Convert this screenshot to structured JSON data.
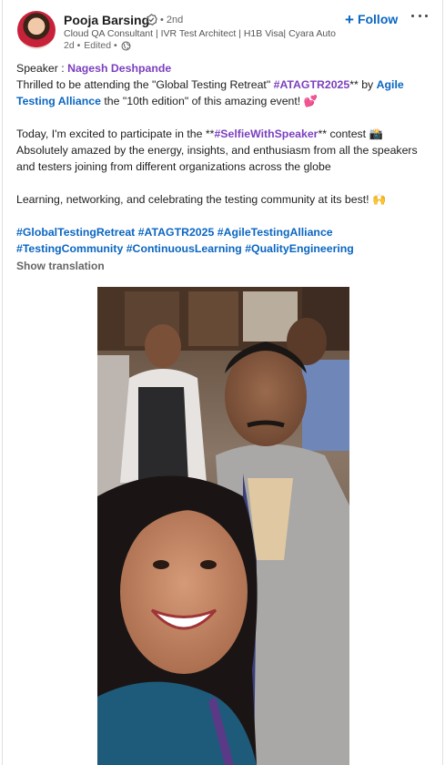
{
  "author": {
    "name": "Pooja Barsing",
    "degree": "• 2nd",
    "headline": "Cloud QA Consultant | IVR Test Architect | H1B Visa| Cyara Auto…",
    "time": "2d •",
    "edited": "Edited •"
  },
  "actions": {
    "follow_label": "Follow",
    "follow_icon": "plus-icon",
    "more_icon": "more-horizontal-icon"
  },
  "post": {
    "speaker_prefix": "Speaker : ",
    "speaker_name": "Nagesh Deshpande",
    "line2_a": "Thrilled to be attending the \"Global Testing Retreat\" ",
    "line2_tag": "#ATAGTR2025",
    "line2_b": "** by ",
    "line2_mention": "Agile Testing Alliance",
    "line2_c": " the \"10th edition\" of this amazing event! 💕",
    "line3_a": "Today, I'm excited to participate in the **",
    "line3_tag": "#SelfieWithSpeaker",
    "line3_b": "** contest 📸 Absolutely amazed by the energy, insights, and enthusiasm from all the speakers and testers joining from different organizations across the globe",
    "line4": "Learning, networking, and celebrating the testing community at its best! 🙌",
    "hashtags": [
      "#GlobalTestingRetreat",
      "#ATAGTR2025",
      "#AgileTestingAlliance",
      "#TestingCommunity",
      "#ContinuousLearning",
      "#QualityEngineering"
    ]
  },
  "show_translation": "Show translation",
  "colors": {
    "accent": "#0a66c2",
    "mention": "#7b3fbf"
  }
}
